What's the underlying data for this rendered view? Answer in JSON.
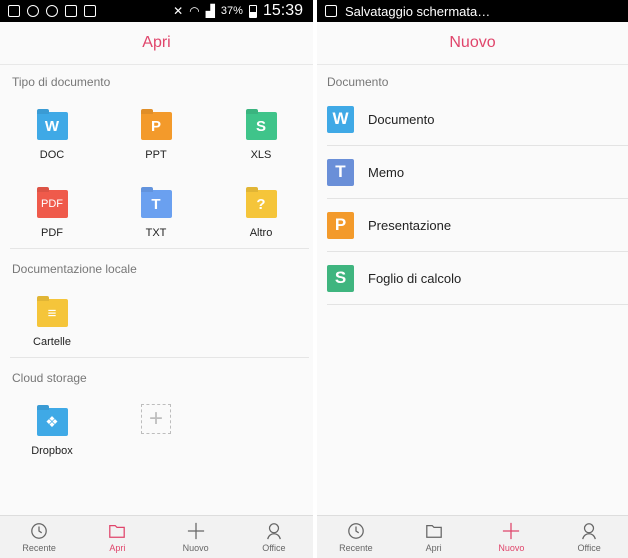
{
  "left": {
    "status": {
      "battery": "37%",
      "time": "15:39"
    },
    "title": "Apri",
    "sections": {
      "doc_type": "Tipo di documento",
      "local": "Documentazione locale",
      "cloud": "Cloud storage"
    },
    "doc_types": [
      {
        "label": "DOC",
        "glyph": "W",
        "color": "#3fa9e6"
      },
      {
        "label": "PPT",
        "glyph": "P",
        "color": "#f39a2b"
      },
      {
        "label": "XLS",
        "glyph": "S",
        "color": "#3fc48a"
      },
      {
        "label": "PDF",
        "glyph": "PDF",
        "color": "#ef5a4b"
      },
      {
        "label": "TXT",
        "glyph": "T",
        "color": "#6aa0f0"
      },
      {
        "label": "Altro",
        "glyph": "?",
        "color": "#f5c53a"
      }
    ],
    "local_items": [
      {
        "label": "Cartelle",
        "glyph": "≡",
        "color": "#f5c53a"
      }
    ],
    "cloud_items": [
      {
        "label": "Dropbox",
        "glyph": "❖",
        "color": "#3fa9e6"
      }
    ],
    "nav": [
      {
        "label": "Recente",
        "icon": "clock-icon"
      },
      {
        "label": "Apri",
        "icon": "folder-icon",
        "active": true
      },
      {
        "label": "Nuovo",
        "icon": "plus-icon"
      },
      {
        "label": "Office",
        "icon": "person-icon"
      }
    ]
  },
  "right": {
    "status": {
      "notification": "Salvataggio schermata…"
    },
    "title": "Nuovo",
    "section": "Documento",
    "items": [
      {
        "label": "Documento",
        "glyph": "W",
        "color": "#3fa9e6"
      },
      {
        "label": "Memo",
        "glyph": "T",
        "color": "#6a8fd8"
      },
      {
        "label": "Presentazione",
        "glyph": "P",
        "color": "#f39a2b"
      },
      {
        "label": "Foglio di calcolo",
        "glyph": "S",
        "color": "#3fb57f"
      }
    ],
    "nav": [
      {
        "label": "Recente",
        "icon": "clock-icon"
      },
      {
        "label": "Apri",
        "icon": "folder-icon"
      },
      {
        "label": "Nuovo",
        "icon": "plus-icon",
        "active": true
      },
      {
        "label": "Office",
        "icon": "person-icon"
      }
    ]
  },
  "colors": {
    "accent": "#e0456b"
  }
}
